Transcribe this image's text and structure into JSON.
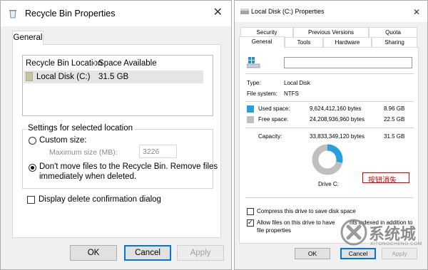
{
  "left_dialog": {
    "title": "Recycle Bin Properties",
    "close_glyph": "✕",
    "tab": "General",
    "list": {
      "columns": [
        "Recycle Bin Location",
        "Space Available"
      ],
      "rows": [
        {
          "location": "Local Disk (C:)",
          "space": "31.5 GB"
        }
      ]
    },
    "settings": {
      "legend": "Settings for selected location",
      "custom_size_label": "Custom size:",
      "max_size_label": "Maximum size (MB):",
      "max_size_value": "3226",
      "dont_move_line1": "Don't move files to the Recycle Bin. Remove files",
      "dont_move_line2": "immediately when deleted."
    },
    "display_confirm_label": "Display delete confirmation dialog",
    "buttons": {
      "ok": "OK",
      "cancel": "Cancel",
      "apply": "Apply"
    }
  },
  "right_dialog": {
    "title": "Local Disk (C:) Properties",
    "close_glyph": "✕",
    "tabs_row1": [
      "Security",
      "Previous Versions",
      "Quota"
    ],
    "tabs_row2": [
      "General",
      "Tools",
      "Hardware",
      "Sharing"
    ],
    "type_label": "Type:",
    "type_value": "Local Disk",
    "fs_label": "File system:",
    "fs_value": "NTFS",
    "used_label": "Used space:",
    "used_bytes": "9,624,412,160 bytes",
    "used_gb": "8.96 GB",
    "free_label": "Free space:",
    "free_bytes": "24,208,936,960 bytes",
    "free_gb": "22.5 GB",
    "capacity_label": "Capacity:",
    "capacity_bytes": "33,833,349,120 bytes",
    "capacity_gb": "31.5 GB",
    "drive_label": "Drive C:",
    "annotation": "按钮消失",
    "compress_label": "Compress this drive to save disk space",
    "index_line1": "Allow files on this drive to have",
    "index_line1_tail": "nts indexed in addition to",
    "index_line2": "file properties",
    "buttons": {
      "ok": "OK",
      "cancel": "Cancel",
      "apply": "Apply"
    },
    "used_fraction": 0.284,
    "colors": {
      "used": "#26a0da",
      "free": "#bfbfbf",
      "annotation": "#e00000"
    }
  },
  "watermark": {
    "text": "系统城",
    "subtext": "XITONGCHENG.COM"
  }
}
